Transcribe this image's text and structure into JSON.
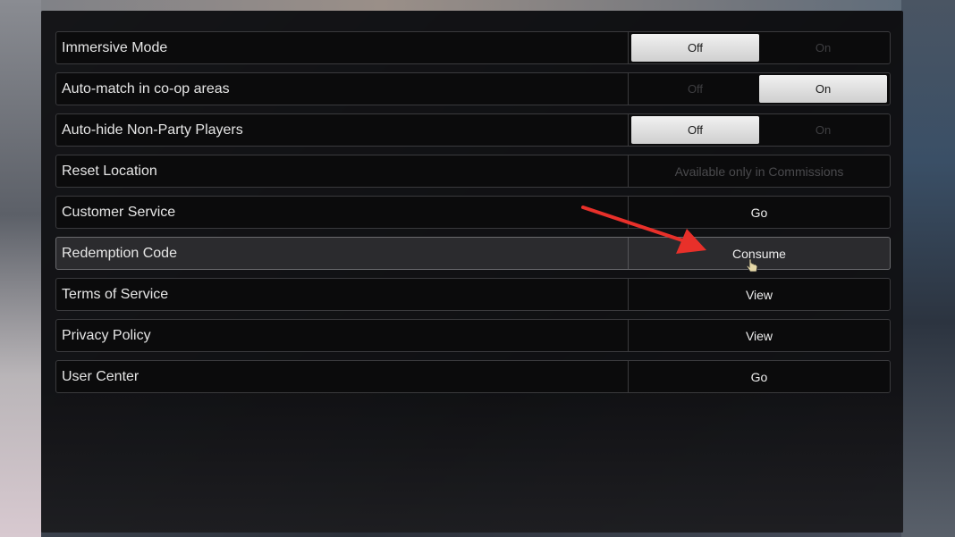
{
  "settings": {
    "rows": [
      {
        "label": "Immersive Mode",
        "off": "Off",
        "on": "On",
        "selected": "off"
      },
      {
        "label": "Auto-match in co-op areas",
        "off": "Off",
        "on": "On",
        "selected": "on"
      },
      {
        "label": "Auto-hide Non-Party Players",
        "off": "Off",
        "on": "On",
        "selected": "off"
      },
      {
        "label": "Reset Location",
        "action": "Available only in Commissions",
        "disabled": true
      },
      {
        "label": "Customer Service",
        "action": "Go"
      },
      {
        "label": "Redemption Code",
        "action": "Consume",
        "highlighted": true
      },
      {
        "label": "Terms of Service",
        "action": "View"
      },
      {
        "label": "Privacy Policy",
        "action": "View"
      },
      {
        "label": "User Center",
        "action": "Go"
      }
    ]
  },
  "annotation": {
    "arrow_color": "#e8302a"
  }
}
